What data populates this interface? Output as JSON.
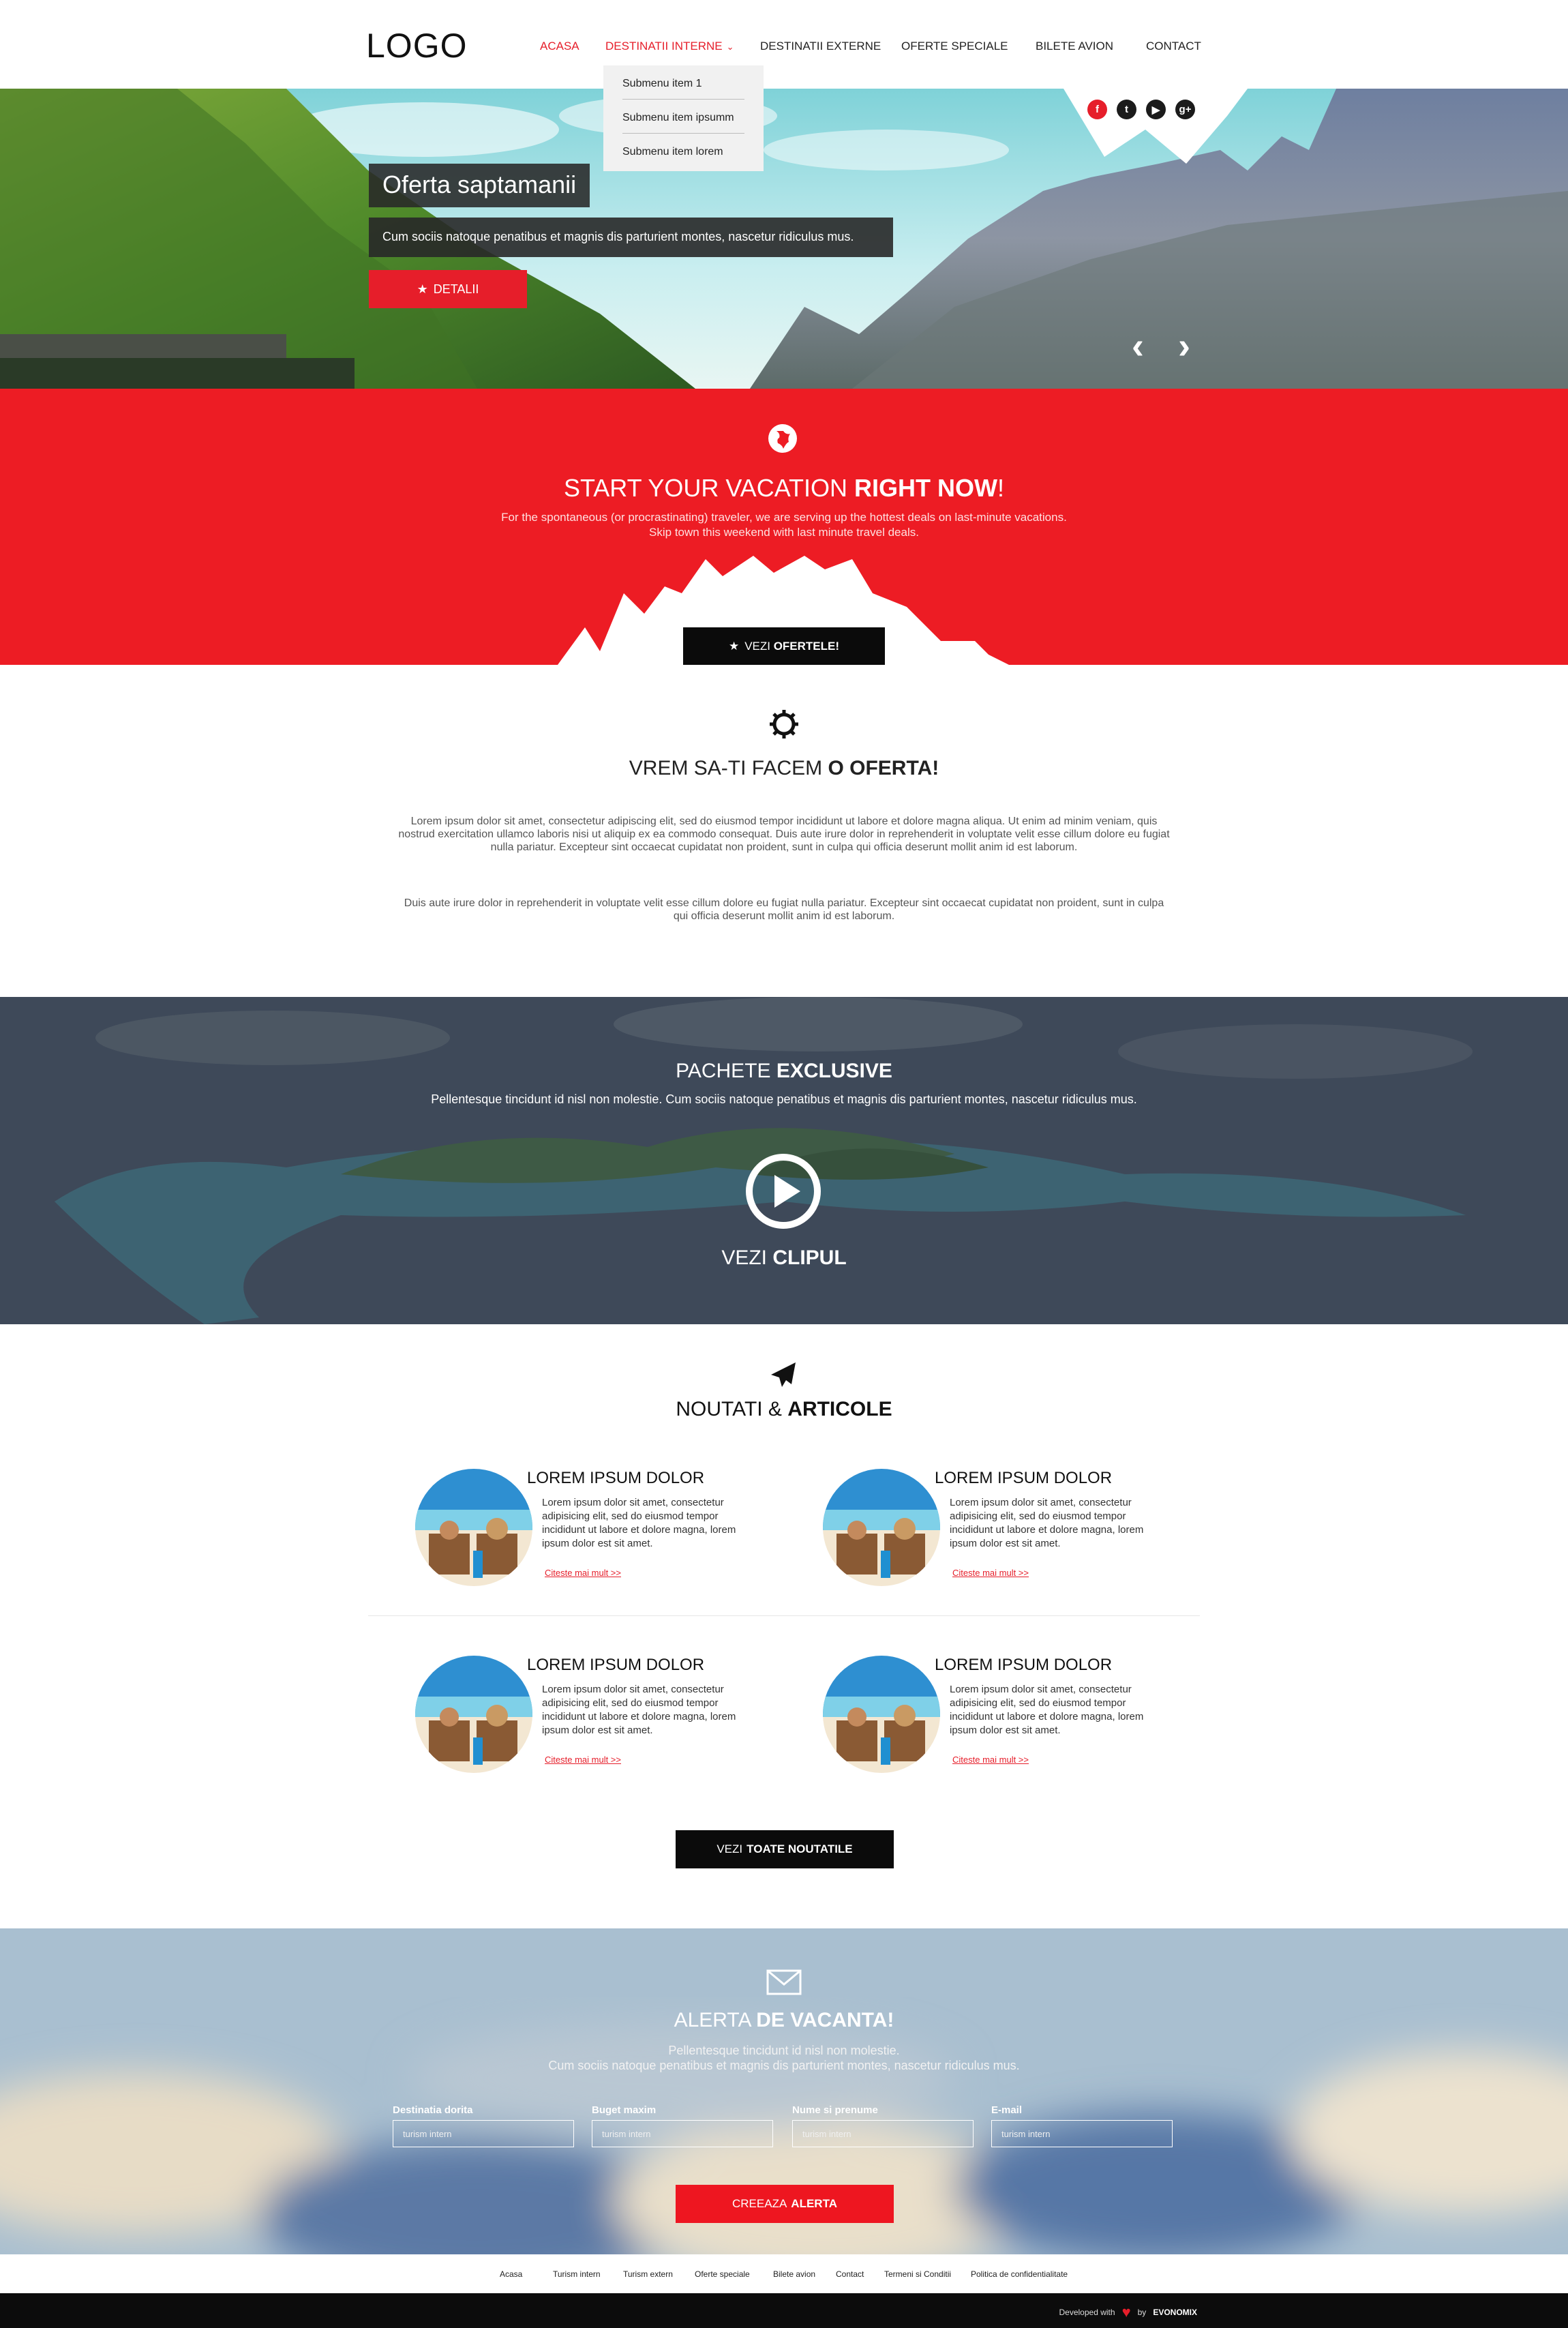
{
  "header": {
    "logo": "LOGO",
    "nav": [
      "ACASA",
      "DESTINATII INTERNE",
      "DESTINATII EXTERNE",
      "OFERTE SPECIALE",
      "BILETE AVION",
      "CONTACT"
    ],
    "dropdown": [
      "Submenu item 1",
      "Submenu item ipsumm",
      "Submenu item lorem"
    ],
    "accent_color": "#e61e2a"
  },
  "social": [
    "f",
    "t",
    "▶",
    "g+"
  ],
  "hero": {
    "title": "Oferta saptamanii",
    "text": "Cum sociis natoque penatibus et magnis dis parturient montes, nascetur ridiculus mus.",
    "button": "DETALII",
    "prev": "‹",
    "next": "›"
  },
  "vacation": {
    "title_light": "START YOUR VACATION ",
    "title_bold": "RIGHT NOW",
    "title_end": "!",
    "line1": "For the spontaneous (or procrastinating) traveler, we are serving up the hottest deals on last-minute vacations.",
    "line2": "Skip town this weekend with last minute travel deals.",
    "button_light": "VEZI ",
    "button_bold": "OFERTELE!"
  },
  "offer": {
    "title_light": "VREM SA-TI FACEM ",
    "title_bold": "O OFERTA!",
    "para1": "Lorem ipsum dolor sit amet, consectetur adipiscing elit, sed do eiusmod tempor incididunt ut labore et dolore magna aliqua. Ut enim ad minim veniam, quis nostrud exercitation ullamco laboris nisi ut aliquip ex ea commodo consequat. Duis aute irure dolor in reprehenderit in voluptate velit esse cillum dolore eu fugiat nulla pariatur. Excepteur sint occaecat cupidatat non proident, sunt in culpa qui officia deserunt mollit anim id est laborum.",
    "para2": "Duis aute irure dolor in reprehenderit in voluptate velit esse cillum dolore eu fugiat nulla pariatur. Excepteur sint occaecat cupidatat non proident, sunt in culpa qui officia deserunt mollit anim id est laborum."
  },
  "packages": {
    "title_light": "PACHETE ",
    "title_bold": "EXCLUSIVE",
    "text": "Pellentesque tincidunt id nisl non molestie. Cum sociis natoque penatibus et magnis dis parturient montes, nascetur ridiculus mus.",
    "video_light": "VEZI ",
    "video_bold": "CLIPUL"
  },
  "news": {
    "title_light": "NOUTATI & ",
    "title_bold": "ARTICOLE",
    "articles": [
      {
        "title": "LOREM IPSUM DOLOR",
        "text": "Lorem ipsum dolor sit amet, consectetur adipisicing elit, sed do eiusmod tempor incididunt ut labore et dolore magna, lorem ipsum dolor est sit amet.",
        "link": "Citeste mai mult >>"
      },
      {
        "title": "LOREM IPSUM DOLOR",
        "text": "Lorem ipsum dolor sit amet, consectetur adipisicing elit, sed do eiusmod tempor incididunt ut labore et dolore magna, lorem ipsum dolor est sit amet.",
        "link": "Citeste mai mult >>"
      },
      {
        "title": "LOREM IPSUM DOLOR",
        "text": "Lorem ipsum dolor sit amet, consectetur adipisicing elit, sed do eiusmod tempor incididunt ut labore et dolore magna, lorem ipsum dolor est sit amet.",
        "link": "Citeste mai mult >>"
      },
      {
        "title": "LOREM IPSUM DOLOR",
        "text": "Lorem ipsum dolor sit amet, consectetur adipisicing elit, sed do eiusmod tempor incididunt ut labore et dolore magna, lorem ipsum dolor est sit amet.",
        "link": "Citeste mai mult >>"
      }
    ],
    "button_light": "VEZI ",
    "button_bold": "TOATE NOUTATILE"
  },
  "alert": {
    "title_light": "ALERTA ",
    "title_bold": "DE VACANTA!",
    "line1": "Pellentesque tincidunt id nisl non molestie.",
    "line2": "Cum sociis natoque penatibus et magnis dis parturient montes, nascetur ridiculus mus.",
    "fields": [
      {
        "label": "Destinatia dorita",
        "placeholder": "turism intern"
      },
      {
        "label": "Buget maxim",
        "placeholder": "turism intern"
      },
      {
        "label": "Nume si prenume",
        "placeholder": "turism intern"
      },
      {
        "label": "E-mail",
        "placeholder": "turism intern"
      }
    ],
    "button_light": "CREEAZA ",
    "button_bold": "ALERTA"
  },
  "footer": {
    "links": [
      "Acasa",
      "Turism intern",
      "Turism extern",
      "Oferte speciale",
      "Bilete avion",
      "Contact",
      "Termeni si Conditii",
      "Politica de confidentialitate"
    ],
    "developed": "Developed with",
    "by": "by",
    "brand": "EVONOMIX"
  }
}
